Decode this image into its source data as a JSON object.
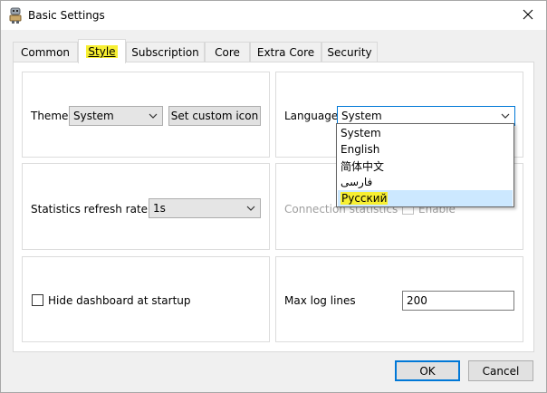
{
  "window": {
    "title": "Basic Settings",
    "icon": "gear-robot-app-icon"
  },
  "tabs": [
    {
      "label": "Common",
      "active": false
    },
    {
      "label": "Style",
      "active": true
    },
    {
      "label": "Subscription",
      "active": false
    },
    {
      "label": "Core",
      "active": false
    },
    {
      "label": "Extra Core",
      "active": false
    },
    {
      "label": "Security",
      "active": false
    }
  ],
  "style": {
    "theme_label": "Theme",
    "theme_value": "System",
    "set_custom_icon_label": "Set custom icon",
    "language_label": "Language",
    "language_value": "System",
    "language_options": [
      {
        "label": "System",
        "selected": false
      },
      {
        "label": "English",
        "selected": false
      },
      {
        "label": "简体中文",
        "selected": false
      },
      {
        "label": "فارسی",
        "selected": false
      },
      {
        "label": "Русский",
        "selected": true
      }
    ],
    "stats_refresh_label": "Statistics refresh rate",
    "stats_refresh_value": "1s",
    "connection_stats_label": "Connection statistics",
    "enable_label": "Enable",
    "hide_dashboard_label": "Hide dashboard at startup",
    "hide_dashboard_checked": false,
    "max_log_lines_label": "Max log lines",
    "max_log_lines_value": "200"
  },
  "footer": {
    "ok_label": "OK",
    "cancel_label": "Cancel"
  },
  "colors": {
    "highlight": "#f7ef32",
    "focus": "#0078d7",
    "selection": "#cce8ff"
  }
}
